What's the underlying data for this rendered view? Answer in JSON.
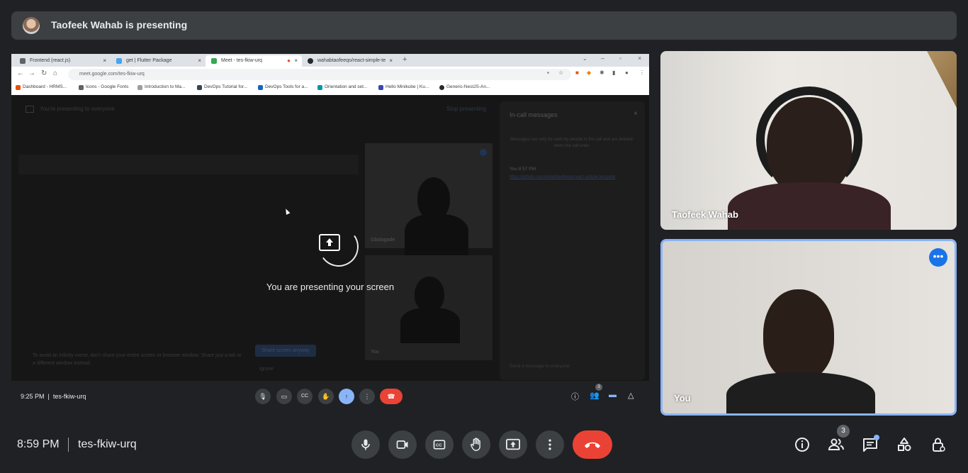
{
  "banner": {
    "text": "Taofeek Wahab is presenting"
  },
  "browser": {
    "tabs": [
      {
        "label": "Frontend (react.js)"
      },
      {
        "label": "get | Flutter Package"
      },
      {
        "label": "Meet - tes-fkiw-urq"
      },
      {
        "label": "wahabtaofeeqo/react-simple-te"
      }
    ],
    "url": "meet.google.com/tes-fkiw-urq",
    "bookmarks": [
      "Dashboard - HRMS...",
      "Icons - Google Fonts",
      "Introduction to Ma...",
      "DevOps Tutorial for...",
      "DevOps Tools for a...",
      "Orientation and set...",
      "Hello Minikube | Ku...",
      "Generic-NestJS-An..."
    ]
  },
  "inner_meet": {
    "presenting_to": "You're presenting to everyone",
    "stop_presenting": "Stop presenting",
    "tile_label_1": "Gbolagade",
    "tile_label_2": "You",
    "chat_title": "In-call messages",
    "chat_notice": "Messages can only be seen by people in the call and are deleted when the call ends",
    "chat_sender": "You  8:57 PM",
    "chat_link": "https://github.com/wahabtaofeeqo/react-simple-template",
    "chat_placeholder": "Send a message to everyone",
    "mirror_warning": "To avoid an infinity mirror, don't share your entire screen or browser window. Share just a tab or a different window instead.",
    "share_button": "Share screen anyway",
    "ignore": "Ignore",
    "presenting_msg": "You are presenting your screen",
    "time": "9:25 PM",
    "code": "tes-fkiw-urq",
    "people_count": "3"
  },
  "participants": [
    {
      "name": "Taofeek Wahab"
    },
    {
      "name": "You"
    }
  ],
  "bottom": {
    "time": "8:59 PM",
    "meeting_code": "tes-fkiw-urq",
    "people_count": "3"
  }
}
